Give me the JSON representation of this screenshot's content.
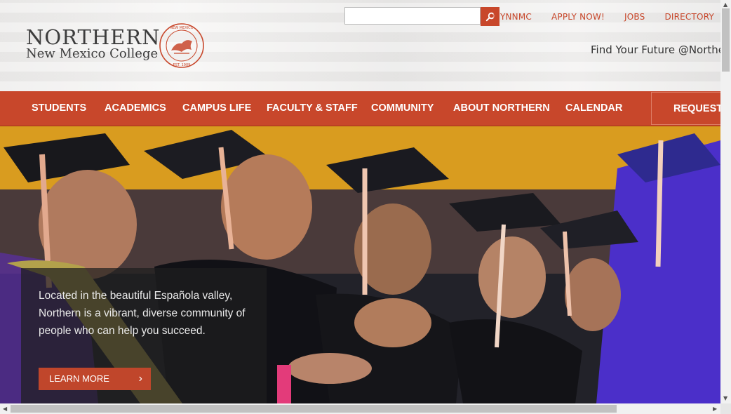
{
  "header": {
    "logo_line1": "NORTHERN",
    "logo_line2": "New Mexico College",
    "seal_text": "NORTHERN NEW MEXICO COLLEGE · EST. 1909",
    "search": {
      "placeholder": "",
      "button_icon": "search-icon"
    },
    "util_links": [
      "MYNNMC",
      "APPLY NOW!",
      "JOBS",
      "DIRECTORY"
    ],
    "tagline": "Find Your Future @Northern"
  },
  "nav": {
    "items": [
      "STUDENTS",
      "ACADEMICS",
      "CAMPUS LIFE",
      "FACULTY & STAFF",
      "COMMUNITY",
      "ABOUT NORTHERN",
      "CALENDAR"
    ],
    "request": "REQUEST INFO"
  },
  "hero": {
    "text": "Located in the beautiful Española valley, Northern is a vibrant, diverse community of people who can help you succeed.",
    "learn_more": "LEARN MORE",
    "learn_more_icon": "chevron-right-icon"
  },
  "colors": {
    "brand": "#c8472b",
    "nav_bg": "#c8472b",
    "text_dark": "#3c3c3c"
  }
}
